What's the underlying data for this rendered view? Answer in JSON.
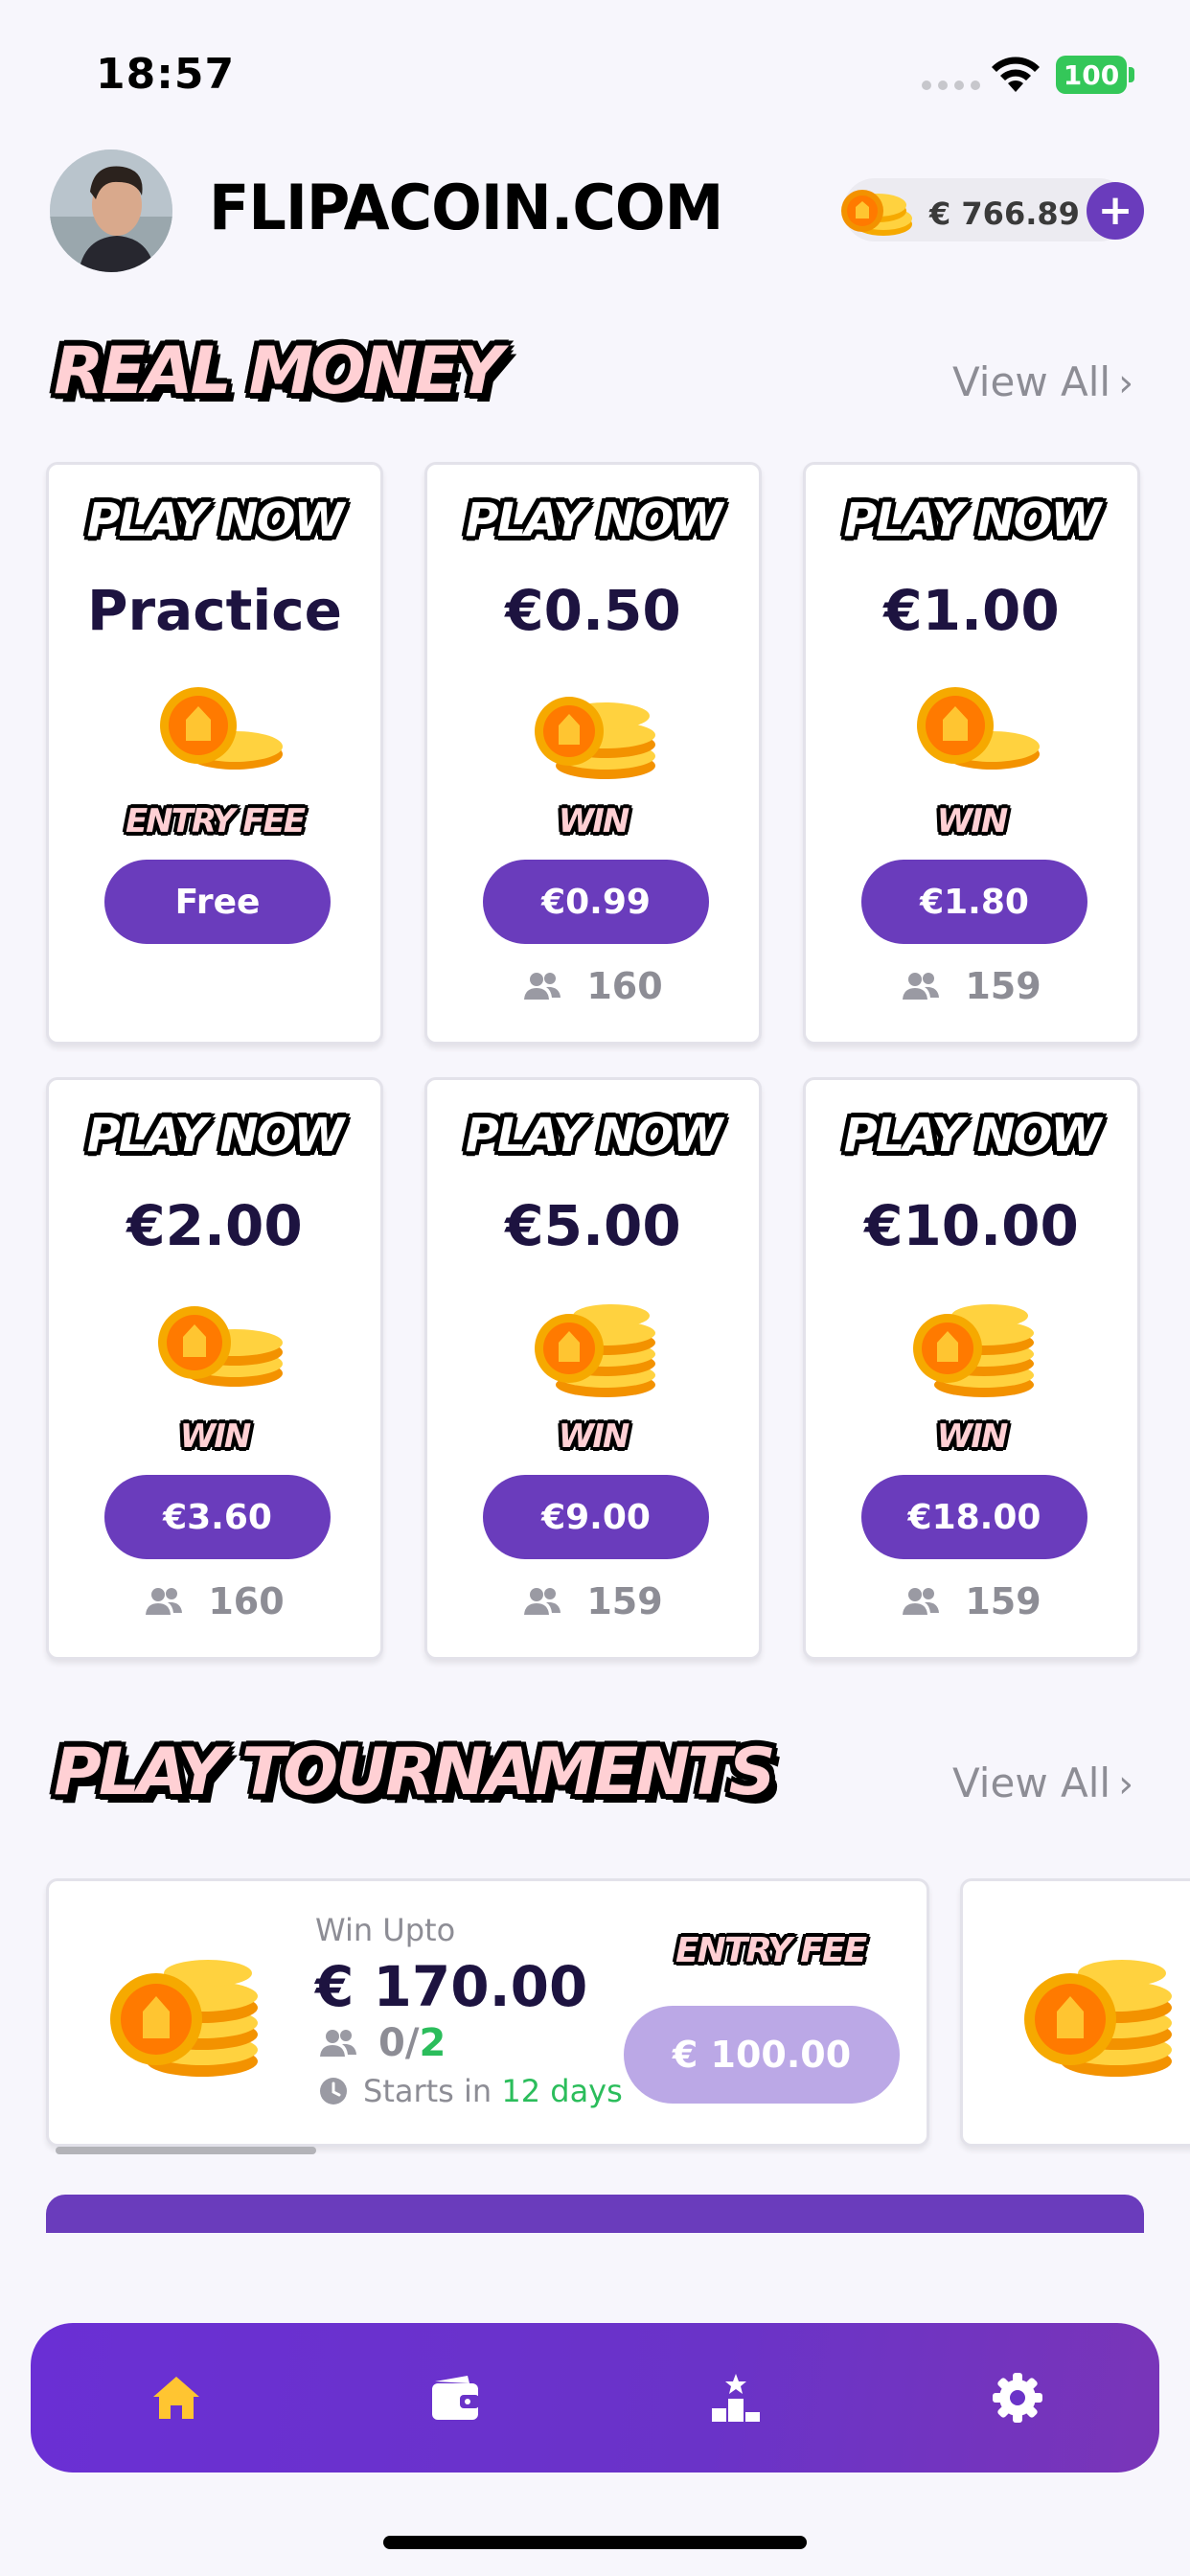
{
  "status_bar": {
    "time": "18:57",
    "battery": "100"
  },
  "header": {
    "brand": "FLIPACOIN.COM",
    "balance": "€ 766.89",
    "add_label": "+"
  },
  "sections": {
    "real_money": {
      "title": "REAL MONEY",
      "view_all": "View All"
    },
    "tournaments": {
      "title": "PLAY TOURNAMENTS",
      "view_all": "View All"
    }
  },
  "games": [
    {
      "play_now": "PLAY NOW",
      "price": "Practice",
      "label": "ENTRY FEE",
      "button": "Free",
      "players": ""
    },
    {
      "play_now": "PLAY NOW",
      "price": "€0.50",
      "label": "WIN",
      "button": "€0.99",
      "players": "160"
    },
    {
      "play_now": "PLAY NOW",
      "price": "€1.00",
      "label": "WIN",
      "button": "€1.80",
      "players": "159"
    },
    {
      "play_now": "PLAY NOW",
      "price": "€2.00",
      "label": "WIN",
      "button": "€3.60",
      "players": "160"
    },
    {
      "play_now": "PLAY NOW",
      "price": "€5.00",
      "label": "WIN",
      "button": "€9.00",
      "players": "159"
    },
    {
      "play_now": "PLAY NOW",
      "price": "€10.00",
      "label": "WIN",
      "button": "€18.00",
      "players": "159"
    }
  ],
  "tournament": {
    "win_upto": "Win Upto",
    "amount": "€ 170.00",
    "players_current": "0/",
    "players_max": "2",
    "starts_prefix": "Starts in",
    "starts_value": "12 days",
    "entry_label": "ENTRY FEE",
    "entry_fee": "€ 100.00"
  },
  "nav": {
    "items": [
      "home-icon",
      "wallet-icon",
      "leaderboard-icon",
      "settings-icon"
    ],
    "active": "home-icon"
  },
  "colors": {
    "accent": "#6a3cbc",
    "nav_active": "#ffc531",
    "green": "#2bbd5b",
    "title_pink": "#ffd0d4"
  }
}
